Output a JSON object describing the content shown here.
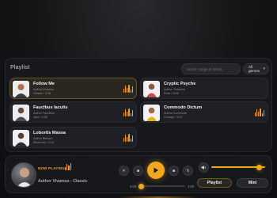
{
  "library": {
    "title": "Playlist",
    "search_placeholder": "Search songs or artists...",
    "genre_selected": "All genres"
  },
  "songs": [
    {
      "title": "Follow Me",
      "artist": "Author Vivamus",
      "meta": "Classic / 3:16",
      "active": true
    },
    {
      "title": "Cryptic Psyche",
      "artist": "Author Tincidunt",
      "meta": "Rock / 3:56",
      "active": false
    },
    {
      "title": "Fauclbus Iaculis",
      "artist": "Author Faucibus",
      "meta": "Jazz / 4:08",
      "active": false
    },
    {
      "title": "Commodo Dictum",
      "artist": "Author Commodo",
      "meta": "Country / 3:41",
      "active": false
    },
    {
      "title": "Lobortis Massa",
      "artist": "Author Bibham",
      "meta": "Electronic / 3:01",
      "active": false
    }
  ],
  "player": {
    "now_playing_label": "NOW PLAYING",
    "track_info": "Author Vivamus - Classic",
    "elapsed": "0:00",
    "duration": "3:00",
    "progress": 0.0,
    "volume": 0.92,
    "playlist_label": "Playlist",
    "mini_label": "Mini",
    "controls": [
      "shuffle-icon",
      "previous-icon",
      "rewind-icon",
      "play-icon",
      "forward-icon",
      "repeat-icon"
    ]
  },
  "colors": {
    "accent": "#f2a81e",
    "panel": "#17181c",
    "background": "#141416"
  }
}
